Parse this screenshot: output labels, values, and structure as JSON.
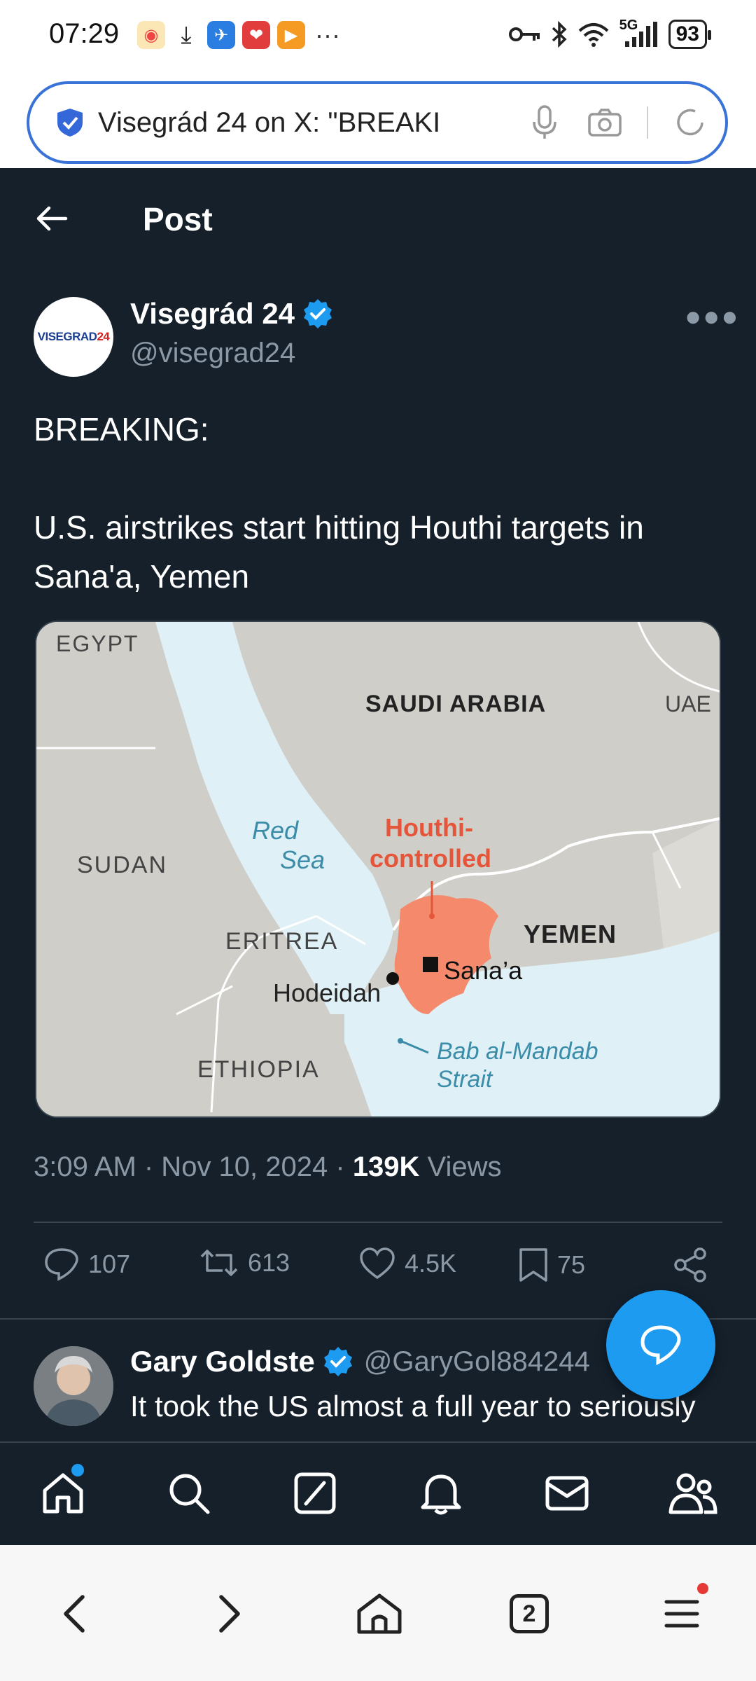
{
  "status_bar": {
    "time": "07:29",
    "battery": "93",
    "network": "5G",
    "more": "···"
  },
  "browser": {
    "url_text": "Visegrád 24 on X: \"BREAKI"
  },
  "header": {
    "title": "Post"
  },
  "post": {
    "author_name": "Visegrád 24",
    "author_handle": "@visegrad24",
    "avatar_text": "VISEGRAD",
    "avatar_text_red": "24",
    "text": "BREAKING:\n\nU.S. airstrikes start hitting Houthi targets in Sana'a, Yemen",
    "time": "3:09 AM · Nov 10, 2024 · ",
    "views_count": "139K",
    "views_label": " Views",
    "replies": "107",
    "reposts": "613",
    "likes": "4.5K",
    "bookmarks": "75"
  },
  "map": {
    "labels": {
      "egypt": "EGYPT",
      "saudi": "SAUDI ARABIA",
      "uae": "UAE",
      "sudan": "SUDAN",
      "red_sea_1": "Red",
      "red_sea_2": "Sea",
      "houthi_1": "Houthi-",
      "houthi_2": "controlled",
      "eritrea": "ERITREA",
      "yemen": "YEMEN",
      "sanaa": "Sana’a",
      "hodeidah": "Hodeidah",
      "ethiopia": "ETHIOPIA",
      "bab_1": "Bab al-Mandab",
      "bab_2": "Strait"
    },
    "colors": {
      "land": "#cfcec9",
      "land_light": "#dcdad5",
      "sea": "#dff0f7",
      "houthi": "#f4896b",
      "houthi_label": "#e5553a",
      "sea_label": "#3a8ca8"
    }
  },
  "reply": {
    "name": "Gary Goldste",
    "handle": "@GaryGol884244",
    "text": "It took the US almost a full year to seriously"
  },
  "colors": {
    "background": "#15202b",
    "accent": "#1d9bf0",
    "muted": "#8b98a5",
    "divider": "#38444d"
  }
}
